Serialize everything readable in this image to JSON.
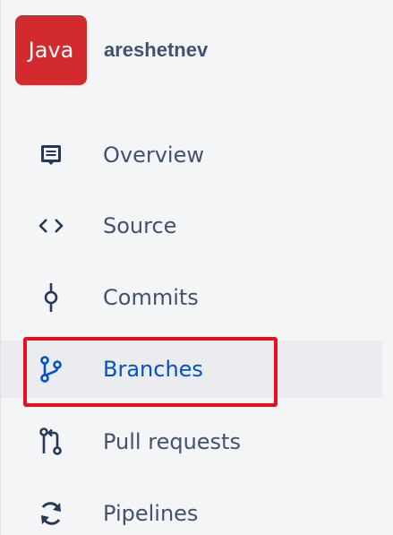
{
  "repo": {
    "avatar_text": "Java",
    "avatar_color": "#d32a2e",
    "name": "areshetnev"
  },
  "nav": {
    "items": [
      {
        "label": "Overview",
        "icon": "overview-icon"
      },
      {
        "label": "Source",
        "icon": "source-code-icon"
      },
      {
        "label": "Commits",
        "icon": "commit-icon"
      },
      {
        "label": "Branches",
        "icon": "branch-icon",
        "selected": true
      },
      {
        "label": "Pull requests",
        "icon": "pull-request-icon"
      },
      {
        "label": "Pipelines",
        "icon": "pipelines-icon"
      }
    ]
  },
  "colors": {
    "text": "#42526e",
    "selected_text": "#0052cc",
    "highlight": "#e5121b",
    "background": "#f4f5f7"
  }
}
